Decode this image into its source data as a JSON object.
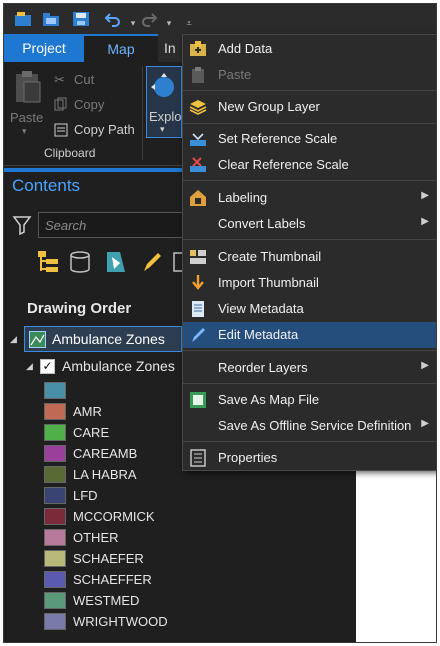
{
  "ribbon": {
    "tabs": {
      "project": "Project",
      "map": "Map",
      "insert": "In"
    },
    "clipboard": {
      "paste": "Paste",
      "cut": "Cut",
      "copy": "Copy",
      "copy_path": "Copy Path",
      "group_label": "Clipboard"
    },
    "explore": "Explo"
  },
  "contents": {
    "title": "Contents",
    "search_placeholder": "Search",
    "drawing_order": "Drawing Order",
    "layer_name": "Ambulance Zones",
    "sublayer_name": "Ambulance Zones",
    "legend": [
      {
        "label": "",
        "color": "#4a8fa8"
      },
      {
        "label": "AMR",
        "color": "#c06a55"
      },
      {
        "label": "CARE",
        "color": "#4fb04a"
      },
      {
        "label": "CAREAMB",
        "color": "#9a3f9a"
      },
      {
        "label": "LA HABRA",
        "color": "#5a6a34"
      },
      {
        "label": "LFD",
        "color": "#3a4472"
      },
      {
        "label": "MCCORMICK",
        "color": "#7a2a38"
      },
      {
        "label": "OTHER",
        "color": "#b77a9a"
      },
      {
        "label": "SCHAEFER",
        "color": "#b8b87a"
      },
      {
        "label": "SCHAEFFER",
        "color": "#5a5ab0"
      },
      {
        "label": "WESTMED",
        "color": "#5a9a7a"
      },
      {
        "label": "WRIGHTWOOD",
        "color": "#7a7aaa"
      }
    ]
  },
  "context_menu": {
    "add_data": "Add Data",
    "paste": "Paste",
    "new_group_layer": "New Group Layer",
    "set_reference_scale": "Set Reference Scale",
    "clear_reference_scale": "Clear Reference Scale",
    "labeling": "Labeling",
    "convert_labels": "Convert Labels",
    "create_thumbnail": "Create Thumbnail",
    "import_thumbnail": "Import Thumbnail",
    "view_metadata": "View Metadata",
    "edit_metadata": "Edit Metadata",
    "reorder_layers": "Reorder Layers",
    "save_as_map_file": "Save As Map File",
    "save_as_offline": "Save As Offline Service Definition",
    "properties": "Properties"
  }
}
